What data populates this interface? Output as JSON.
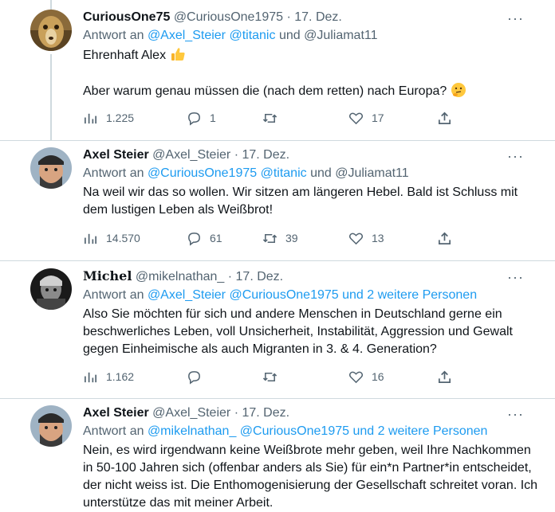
{
  "tweets": [
    {
      "display_name": "CuriousOne75",
      "handle": "@CuriousOne1975",
      "date": "· 17. Dez.",
      "reply_prefix": "Antwort an",
      "reply_links": "@Axel_Steier @titanic",
      "reply_plain": "und @Juliamat11",
      "body_line1": "Ehrenhaft Alex",
      "body_line2": "Aber warum genau müssen die (nach dem retten) nach Europa?",
      "views": "1.225",
      "replies": "1",
      "retweets": "",
      "likes": "17"
    },
    {
      "display_name": "Axel Steier",
      "handle": "@Axel_Steier",
      "date": "· 17. Dez.",
      "reply_prefix": "Antwort an",
      "reply_links": "@CuriousOne1975 @titanic",
      "reply_plain": "und @Juliamat11",
      "body": "Na weil wir das so wollen. Wir sitzen am längeren Hebel. Bald ist Schluss mit dem lustigen Leben als Weißbrot!",
      "views": "14.570",
      "replies": "61",
      "retweets": "39",
      "likes": "13"
    },
    {
      "display_name": "Michel",
      "handle": "@mikelnathan_",
      "date": "· 17. Dez.",
      "reply_prefix": "Antwort an",
      "reply_links": "@Axel_Steier @CuriousOne1975 und 2 weitere Personen",
      "body": "Also Sie möchten für sich und andere Menschen in Deutschland gerne ein beschwerliches Leben, voll Unsicherheit, Instabilität, Aggression und Gewalt gegen Einheimische als auch Migranten in 3. & 4. Generation?",
      "views": "1.162",
      "replies": "",
      "retweets": "",
      "likes": "16"
    },
    {
      "display_name": "Axel Steier",
      "handle": "@Axel_Steier",
      "date": "· 17. Dez.",
      "reply_prefix": "Antwort an",
      "reply_links": "@mikelnathan_ @CuriousOne1975 und 2 weitere Personen",
      "body": "Nein, es wird irgendwann keine Weißbrote mehr geben, weil Ihre Nachkommen in 50-100 Jahren sich (offenbar anders als Sie) für ein*n Partner*in entscheidet, der nicht weiss ist. Die Enthomogenisierung der Gesellschaft schreitet voran. Ich unterstütze das mit meiner Arbeit."
    }
  ],
  "colors": {
    "link": "#1d9bf0",
    "muted": "#536471",
    "text": "#0f1419",
    "divider": "#cfd9de"
  },
  "icons": [
    "views-icon",
    "reply-icon",
    "retweet-icon",
    "like-icon",
    "share-icon",
    "more-icon"
  ]
}
